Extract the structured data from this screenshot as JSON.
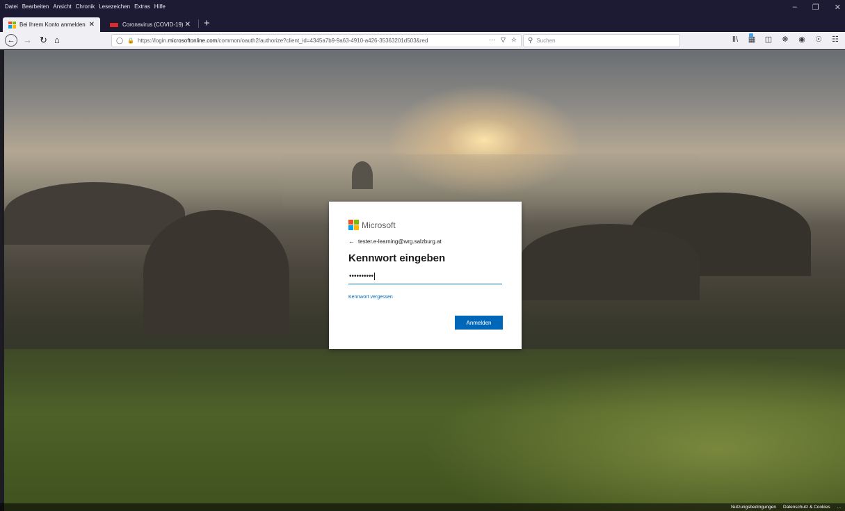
{
  "menubar": {
    "items": [
      "Datei",
      "Bearbeiten",
      "Ansicht",
      "Chronik",
      "Lesezeichen",
      "Extras",
      "Hilfe"
    ],
    "window_controls": [
      "minimize-icon",
      "restore-icon",
      "close-icon"
    ]
  },
  "tabs": [
    {
      "title": "Bei Ihrem Konto anmelden",
      "active": true
    },
    {
      "title": "Coronavirus (COVID-19)",
      "active": false
    }
  ],
  "navbar": {
    "url_prefix": "https://login.",
    "url_domain": "microsoftonline.com",
    "url_rest": "/common/oauth2/authorize?client_id=4345a7b9-9a63-4910-a426-35363201d503&red",
    "search_placeholder": "Suchen"
  },
  "card": {
    "brand": "Microsoft",
    "identity": "tester.e-learning@wrg.salzburg.at",
    "title": "Kennwort eingeben",
    "password_mask": "••••••••••",
    "forgot_link": "Kennwort vergessen",
    "signin_button": "Anmelden"
  },
  "footer": {
    "terms": "Nutzungsbedingungen",
    "privacy": "Datenschutz & Cookies",
    "more": "..."
  },
  "colors": {
    "accent": "#0067b8",
    "chrome_dark": "#1c1b33",
    "toolbar": "#f0f0f4"
  }
}
